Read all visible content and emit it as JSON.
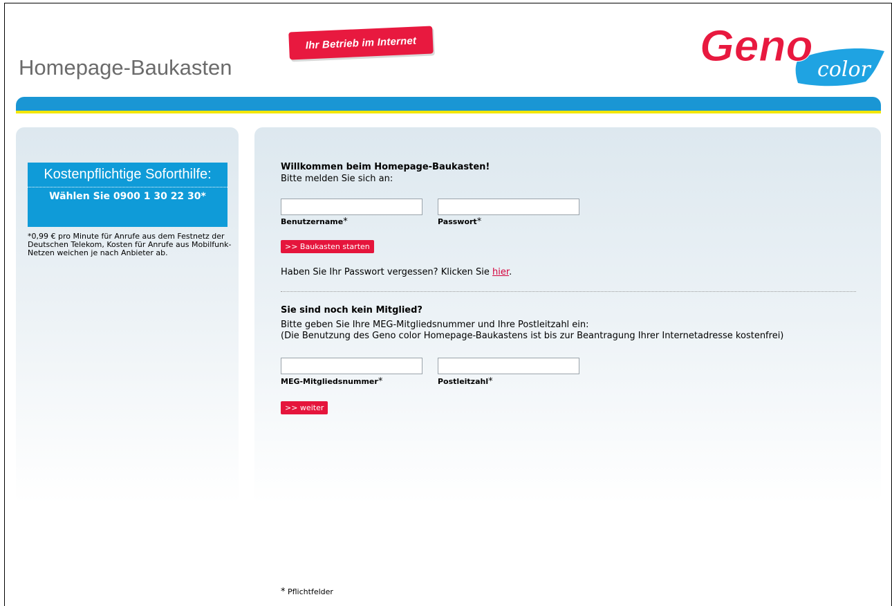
{
  "header": {
    "site_title": "Homepage-Baukasten",
    "tag_banner": "Ihr Betrieb im Internet",
    "logo_text_main": "Geno",
    "logo_text_sub": "color"
  },
  "sidebar": {
    "hotline_title": "Kostenpflichtige Soforthilfe:",
    "hotline_number": "Wählen Sie 0900 1 30 22 30*",
    "cost_note": "*0,99 € pro Minute für Anrufe aus dem Festnetz der Deutschen Telekom, Kosten für Anrufe aus Mobilfunk-Netzen weichen je nach Anbieter ab."
  },
  "login": {
    "heading": "Willkommen beim Homepage-Baukasten!",
    "prompt": "Bitte melden Sie sich an:",
    "username_label": "Benutzername",
    "password_label": "Passwort",
    "username_value": "",
    "password_value": "",
    "submit_label": ">> Baukasten starten",
    "forgot_text": "Haben Sie Ihr Passwort vergessen? Klicken Sie ",
    "forgot_link": "hier",
    "forgot_end": "."
  },
  "register": {
    "heading": "Sie sind noch kein Mitglied?",
    "prompt_line1": "Bitte geben Sie Ihre MEG-Mitgliedsnummer und Ihre Postleitzahl ein:",
    "prompt_line2": "(Die Benutzung des Geno color Homepage-Baukastens ist bis zur Beantragung Ihrer Internetadresse kostenfrei)",
    "member_label": "MEG-Mitgliedsnummer",
    "zip_label": "Postleitzahl",
    "member_value": "",
    "zip_value": "",
    "submit_label": ">> weiter"
  },
  "required_star": "*",
  "footer": {
    "note": "Pflichtfelder"
  },
  "colors": {
    "brand_red": "#e5153c",
    "brand_blue": "#1a96d4",
    "brand_yellow": "#f3e600"
  }
}
